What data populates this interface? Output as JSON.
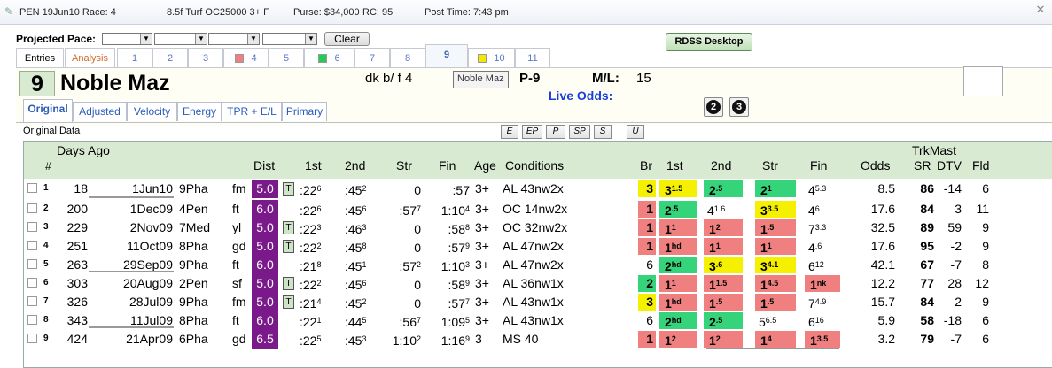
{
  "title_bar": {
    "track_race": "PEN 19Jun10 Race: 4",
    "conditions": "8.5f  Turf  OC25000  3+ F",
    "purse": "Purse: $34,000",
    "rc": "RC: 95",
    "post_time": "Post Time: 7:43 pm"
  },
  "pace": {
    "label": "Projected Pace:",
    "clear_label": "Clear"
  },
  "rdss_button": "RDSS Desktop",
  "tabs": {
    "entries": "Entries",
    "analysis": "Analysis",
    "races": [
      {
        "label": "1",
        "marker": ""
      },
      {
        "label": "2",
        "marker": ""
      },
      {
        "label": "3",
        "marker": ""
      },
      {
        "label": "4",
        "marker": "#f08080"
      },
      {
        "label": "5",
        "marker": ""
      },
      {
        "label": "6",
        "marker": "#22cc55"
      },
      {
        "label": "7",
        "marker": ""
      },
      {
        "label": "8",
        "marker": ""
      },
      {
        "label": "9",
        "marker": ""
      },
      {
        "label": "10",
        "marker": "#f5e800"
      },
      {
        "label": "11",
        "marker": ""
      }
    ],
    "active_race": "9"
  },
  "horse": {
    "program": "9",
    "name": "Noble Maz",
    "color_sex_age": "dk b/ f 4",
    "post_fragment": "P-9",
    "ml_label": "M/L:",
    "ml_value": "15",
    "live_odds_label": "Live Odds:",
    "tooltip": "Noble Maz"
  },
  "extra_buttons": [
    "2",
    "3"
  ],
  "views": {
    "tabs": [
      "Original",
      "Adjusted",
      "Velocity",
      "Energy",
      "TPR + E/L",
      "Primary"
    ],
    "active": "Original",
    "section_label": "Original Data",
    "filters": [
      "E",
      "EP",
      "P",
      "SP",
      "S",
      "U"
    ]
  },
  "grid": {
    "headers": {
      "num": "#",
      "days_ago": "Days Ago",
      "dist": "Dist",
      "first": "1st",
      "second": "2nd",
      "str": "Str",
      "fin": "Fin",
      "age": "Age",
      "conditions": "Conditions",
      "br": "Br",
      "c1st": "1st",
      "c2nd": "2nd",
      "cstr": "Str",
      "cfin": "Fin",
      "odds": "Odds",
      "trkmast": "TrkMast",
      "sr": "SR",
      "dtv": "DTV",
      "fld": "Fld"
    },
    "rows": [
      {
        "n": "1",
        "days": "18",
        "date": "1Jun10",
        "race": "9Pha",
        "cond": "fm",
        "dist": "5.0",
        "distc": "#7a1a8a",
        "t": "T",
        "f1": ":22",
        "f1s": "6",
        "f2": ":45",
        "f2s": "2",
        "st": "0",
        "sts": "",
        "fn": ":57",
        "fns": "",
        "age": "3+",
        "conds": "AL 43nw2x",
        "br": "3",
        "brc": "#f5ef00",
        "c1": "3",
        "c1s": "1.5",
        "c1c": "#f5ef00",
        "c2": "2",
        "c2s": ".5",
        "c2c": "#36d47a",
        "cs": "2",
        "css": "1",
        "csc": "#36d47a",
        "cf": "4",
        "cfs": "5.3",
        "cfc": "",
        "odds": "8.5",
        "sr": "86",
        "dtv": "-14",
        "fld": "6"
      },
      {
        "n": "2",
        "days": "200",
        "date": "1Dec09",
        "race": "4Pen",
        "cond": "ft",
        "dist": "6.0",
        "distc": "#7a1a8a",
        "t": "",
        "f1": ":22",
        "f1s": "6",
        "f2": ":45",
        "f2s": "6",
        "st": ":57",
        "sts": "7",
        "fn": "1:10",
        "fns": "4",
        "age": "3+",
        "conds": "OC 14nw2x",
        "br": "1",
        "brc": "#f08080",
        "c1": "2",
        "c1s": ".5",
        "c1c": "#36d47a",
        "c2": "4",
        "c2s": "1.6",
        "c2c": "",
        "cs": "3",
        "css": "3.5",
        "csc": "#f5ef00",
        "cf": "4",
        "cfs": "6",
        "cfc": "",
        "odds": "17.6",
        "sr": "84",
        "dtv": "3",
        "fld": "11"
      },
      {
        "n": "3",
        "days": "229",
        "date": "2Nov09",
        "race": "7Med",
        "cond": "yl",
        "dist": "5.0",
        "distc": "#7a1a8a",
        "t": "T",
        "f1": ":22",
        "f1s": "3",
        "f2": ":46",
        "f2s": "3",
        "st": "0",
        "sts": "",
        "fn": ":58",
        "fns": "8",
        "age": "3+",
        "conds": "OC 32nw2x",
        "br": "1",
        "brc": "#f08080",
        "c1": "1",
        "c1s": "1",
        "c1c": "#f08080",
        "c2": "1",
        "c2s": "2",
        "c2c": "#f08080",
        "cs": "1",
        "css": ".5",
        "csc": "#f08080",
        "cf": "7",
        "cfs": "3.3",
        "cfc": "",
        "odds": "32.5",
        "sr": "89",
        "dtv": "59",
        "fld": "9"
      },
      {
        "n": "4",
        "days": "251",
        "date": "11Oct09",
        "race": "8Pha",
        "cond": "gd",
        "dist": "5.0",
        "distc": "#7a1a8a",
        "t": "T",
        "f1": ":22",
        "f1s": "2",
        "f2": ":45",
        "f2s": "8",
        "st": "0",
        "sts": "",
        "fn": ":57",
        "fns": "9",
        "age": "3+",
        "conds": "AL 47nw2x",
        "br": "1",
        "brc": "#f08080",
        "c1": "1",
        "c1s": "hd",
        "c1c": "#f08080",
        "c2": "1",
        "c2s": "1",
        "c2c": "#f08080",
        "cs": "1",
        "css": "1",
        "csc": "#f08080",
        "cf": "4",
        "cfs": ".6",
        "cfc": "",
        "odds": "17.6",
        "sr": "95",
        "dtv": "-2",
        "fld": "9"
      },
      {
        "n": "5",
        "days": "263",
        "date": "29Sep09",
        "race": "9Pha",
        "cond": "ft",
        "dist": "6.0",
        "distc": "#7a1a8a",
        "t": "",
        "f1": ":21",
        "f1s": "8",
        "f2": ":45",
        "f2s": "1",
        "st": ":57",
        "sts": "2",
        "fn": "1:10",
        "fns": "3",
        "age": "3+",
        "conds": "AL 47nw2x",
        "br": "6",
        "brc": "",
        "c1": "2",
        "c1s": "hd",
        "c1c": "#36d47a",
        "c2": "3",
        "c2s": ".6",
        "c2c": "#f5ef00",
        "cs": "3",
        "css": "4.1",
        "csc": "#f5ef00",
        "cf": "6",
        "cfs": "12",
        "cfc": "",
        "odds": "42.1",
        "sr": "67",
        "dtv": "-7",
        "fld": "8"
      },
      {
        "n": "6",
        "days": "303",
        "date": "20Aug09",
        "race": "2Pen",
        "cond": "sf",
        "dist": "5.0",
        "distc": "#7a1a8a",
        "t": "T",
        "f1": ":22",
        "f1s": "2",
        "f2": ":45",
        "f2s": "6",
        "st": "0",
        "sts": "",
        "fn": ":58",
        "fns": "9",
        "age": "3+",
        "conds": "AL 36nw1x",
        "br": "2",
        "brc": "#36d47a",
        "c1": "1",
        "c1s": "1",
        "c1c": "#f08080",
        "c2": "1",
        "c2s": "1.5",
        "c2c": "#f08080",
        "cs": "1",
        "css": "4.5",
        "csc": "#f08080",
        "cf": "1",
        "cfs": "nk",
        "cfc": "#f08080",
        "odds": "12.2",
        "sr": "77",
        "dtv": "28",
        "fld": "12"
      },
      {
        "n": "7",
        "days": "326",
        "date": "28Jul09",
        "race": "9Pha",
        "cond": "fm",
        "dist": "5.0",
        "distc": "#7a1a8a",
        "t": "T",
        "f1": ":21",
        "f1s": "4",
        "f2": ":45",
        "f2s": "2",
        "st": "0",
        "sts": "",
        "fn": ":57",
        "fns": "7",
        "age": "3+",
        "conds": "AL 43nw1x",
        "br": "3",
        "brc": "#f5ef00",
        "c1": "1",
        "c1s": "hd",
        "c1c": "#f08080",
        "c2": "1",
        "c2s": ".5",
        "c2c": "#f08080",
        "cs": "1",
        "css": ".5",
        "csc": "#f08080",
        "cf": "7",
        "cfs": "4.9",
        "cfc": "",
        "odds": "15.7",
        "sr": "84",
        "dtv": "2",
        "fld": "9"
      },
      {
        "n": "8",
        "days": "343",
        "date": "11Jul09",
        "race": "8Pha",
        "cond": "ft",
        "dist": "6.0",
        "distc": "#7a1a8a",
        "t": "",
        "f1": ":22",
        "f1s": "1",
        "f2": ":44",
        "f2s": "5",
        "st": ":56",
        "sts": "7",
        "fn": "1:09",
        "fns": "5",
        "age": "3+",
        "conds": "AL 43nw1x",
        "br": "6",
        "brc": "",
        "c1": "2",
        "c1s": "hd",
        "c1c": "#36d47a",
        "c2": "2",
        "c2s": ".5",
        "c2c": "#36d47a",
        "cs": "5",
        "css": "6.5",
        "csc": "",
        "cf": "6",
        "cfs": "16",
        "cfc": "",
        "odds": "5.9",
        "sr": "58",
        "dtv": "-18",
        "fld": "6"
      },
      {
        "n": "9",
        "days": "424",
        "date": "21Apr09",
        "race": "6Pha",
        "cond": "gd",
        "dist": "6.5",
        "distc": "#7a1a8a",
        "t": "",
        "f1": ":22",
        "f1s": "5",
        "f2": ":45",
        "f2s": "3",
        "st": "1:10",
        "sts": "2",
        "fn": "1:16",
        "fns": "9",
        "age": "3",
        "conds": "MS 40",
        "br": "1",
        "brc": "#f08080",
        "c1": "1",
        "c1s": "2",
        "c1c": "#f08080",
        "c2": "1",
        "c2s": "2",
        "c2c": "#f08080",
        "cs": "1",
        "css": "4",
        "csc": "#f08080",
        "cf": "1",
        "cfs": "3.5",
        "cfc": "#f08080",
        "odds": "3.2",
        "sr": "79",
        "dtv": "-7",
        "fld": "6"
      }
    ]
  }
}
